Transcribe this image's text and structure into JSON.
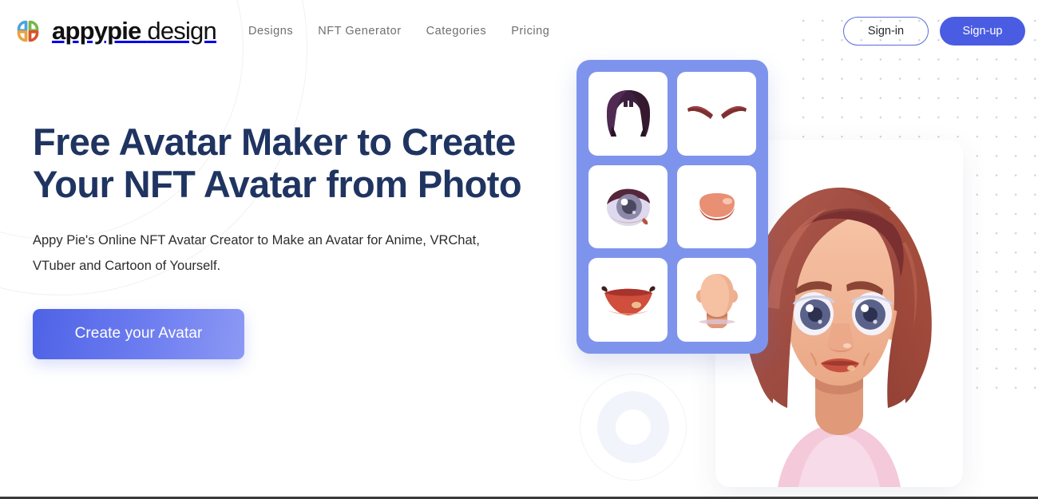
{
  "brand": {
    "name_bold": "appypie",
    "name_light": "design",
    "logo_icon": "appypie-petal-logo",
    "logo_colors": [
      "#4da3dd",
      "#7ab648",
      "#e8a33d",
      "#d9532c"
    ]
  },
  "nav": {
    "items": [
      {
        "label": "Designs",
        "name": "nav-link-designs"
      },
      {
        "label": "NFT Generator",
        "name": "nav-link-nft-generator"
      },
      {
        "label": "Categories",
        "name": "nav-link-categories"
      },
      {
        "label": "Pricing",
        "name": "nav-link-pricing"
      }
    ]
  },
  "auth": {
    "signin_label": "Sign-in",
    "signup_label": "Sign-up",
    "signup_bg": "#4a5ce2",
    "signin_border": "#5a6bd8"
  },
  "hero": {
    "title_line1": "Free Avatar Maker to Create",
    "title_line2": "Your NFT Avatar from Photo",
    "title_color": "#1f3461",
    "subtitle": "Appy Pie's Online NFT Avatar Creator to Make an Avatar for Anime, VRChat, VTuber and Cartoon of Yourself.",
    "cta_label": "Create your Avatar",
    "cta_gradient_from": "#4e62e6",
    "cta_gradient_to": "#8c99f4"
  },
  "illustration": {
    "picker_bg": "#7e94ec",
    "tiles": [
      {
        "name": "avatar-part-tile-hair",
        "icon": "hair-icon"
      },
      {
        "name": "avatar-part-tile-eyebrows",
        "icon": "eyebrows-icon"
      },
      {
        "name": "avatar-part-tile-eye",
        "icon": "eye-icon"
      },
      {
        "name": "avatar-part-tile-nose",
        "icon": "nose-icon"
      },
      {
        "name": "avatar-part-tile-mouth",
        "icon": "mouth-icon"
      },
      {
        "name": "avatar-part-tile-face",
        "icon": "face-shape-icon"
      }
    ],
    "avatar_preview": "female-avatar-auburn-bob",
    "hair_color": "#9e4a42",
    "skin_color": "#f2b89a",
    "shirt_color": "#f4c9da",
    "eye_color": "#5b628a"
  },
  "decor": {
    "dot_color": "#c3cbe0",
    "circle_color": "#f1f1f3"
  }
}
